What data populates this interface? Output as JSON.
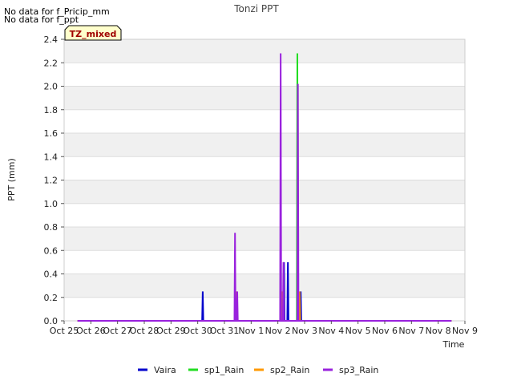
{
  "notices": [
    "No data for f_Pricip_mm",
    "No data for f_ppt"
  ],
  "badge": "TZ_mixed",
  "colors": {
    "Vaira": "#0000cc",
    "sp1_Rain": "#22dd22",
    "sp2_Rain": "#ff9900",
    "sp3_Rain": "#9922dd",
    "band": "#f0f0f0",
    "badge_bg": "#ffffcc"
  },
  "chart_data": {
    "type": "line",
    "title": "Tonzi PPT",
    "xlabel": "Time",
    "ylabel": "PPT (mm)",
    "xlim": [
      "2024-10-25",
      "2024-11-09"
    ],
    "ylim": [
      0,
      2.4
    ],
    "x_ticks": [
      "Oct 25",
      "Oct 26",
      "Oct 27",
      "Oct 28",
      "Oct 29",
      "Oct 30",
      "Oct 31",
      "Nov 1",
      "Nov 2",
      "Nov 3",
      "Nov 4",
      "Nov 5",
      "Nov 6",
      "Nov 7",
      "Nov 8",
      "Nov 9"
    ],
    "y_ticks": [
      "0.0",
      "0.2",
      "0.4",
      "0.6",
      "0.8",
      "1.0",
      "1.2",
      "1.4",
      "1.6",
      "1.8",
      "2.0",
      "2.2",
      "2.4"
    ],
    "grid": true,
    "legend_position": "bottom",
    "series": [
      {
        "name": "Vaira",
        "points": [
          [
            "2024-10-25 12:00",
            0
          ],
          [
            "2024-10-30 04:00",
            0
          ],
          [
            "2024-10-30 04:30",
            0.25
          ],
          [
            "2024-10-30 05:00",
            0
          ],
          [
            "2024-11-02 05:00",
            0
          ],
          [
            "2024-11-02 05:30",
            0.5
          ],
          [
            "2024-11-02 06:00",
            0
          ],
          [
            "2024-11-02 08:30",
            0
          ],
          [
            "2024-11-02 09:00",
            0.5
          ],
          [
            "2024-11-02 09:30",
            0
          ],
          [
            "2024-11-02 20:00",
            0
          ],
          [
            "2024-11-02 20:30",
            0.25
          ],
          [
            "2024-11-02 21:00",
            0
          ],
          [
            "2024-11-08 12:00",
            0
          ]
        ]
      },
      {
        "name": "sp1_Rain",
        "points": [
          [
            "2024-10-25 12:00",
            0
          ],
          [
            "2024-11-02 17:00",
            0
          ],
          [
            "2024-11-02 17:30",
            2.28
          ],
          [
            "2024-11-02 18:00",
            0
          ],
          [
            "2024-11-08 12:00",
            0
          ]
        ]
      },
      {
        "name": "sp2_Rain",
        "points": [
          [
            "2024-10-25 12:00",
            0
          ],
          [
            "2024-10-31 10:00",
            0
          ],
          [
            "2024-10-31 10:30",
            0.25
          ],
          [
            "2024-10-31 11:00",
            0
          ],
          [
            "2024-11-02 03:00",
            0
          ],
          [
            "2024-11-02 03:30",
            0.25
          ],
          [
            "2024-11-02 04:00",
            0
          ],
          [
            "2024-11-02 19:00",
            0
          ],
          [
            "2024-11-02 19:30",
            0.25
          ],
          [
            "2024-11-02 20:00",
            0
          ],
          [
            "2024-11-08 12:00",
            0
          ]
        ]
      },
      {
        "name": "sp3_Rain",
        "points": [
          [
            "2024-10-25 12:00",
            0
          ],
          [
            "2024-10-31 09:00",
            0
          ],
          [
            "2024-10-31 09:30",
            0.75
          ],
          [
            "2024-10-31 10:00",
            0
          ],
          [
            "2024-10-31 11:00",
            0
          ],
          [
            "2024-10-31 11:30",
            0.25
          ],
          [
            "2024-10-31 12:00",
            0
          ],
          [
            "2024-11-02 02:00",
            0
          ],
          [
            "2024-11-02 02:30",
            2.28
          ],
          [
            "2024-11-02 03:00",
            0
          ],
          [
            "2024-11-02 04:30",
            0
          ],
          [
            "2024-11-02 05:00",
            0.5
          ],
          [
            "2024-11-02 05:30",
            0
          ],
          [
            "2024-11-02 17:30",
            0
          ],
          [
            "2024-11-02 18:00",
            2.02
          ],
          [
            "2024-11-02 18:30",
            0
          ],
          [
            "2024-11-08 12:00",
            0
          ]
        ]
      }
    ]
  }
}
